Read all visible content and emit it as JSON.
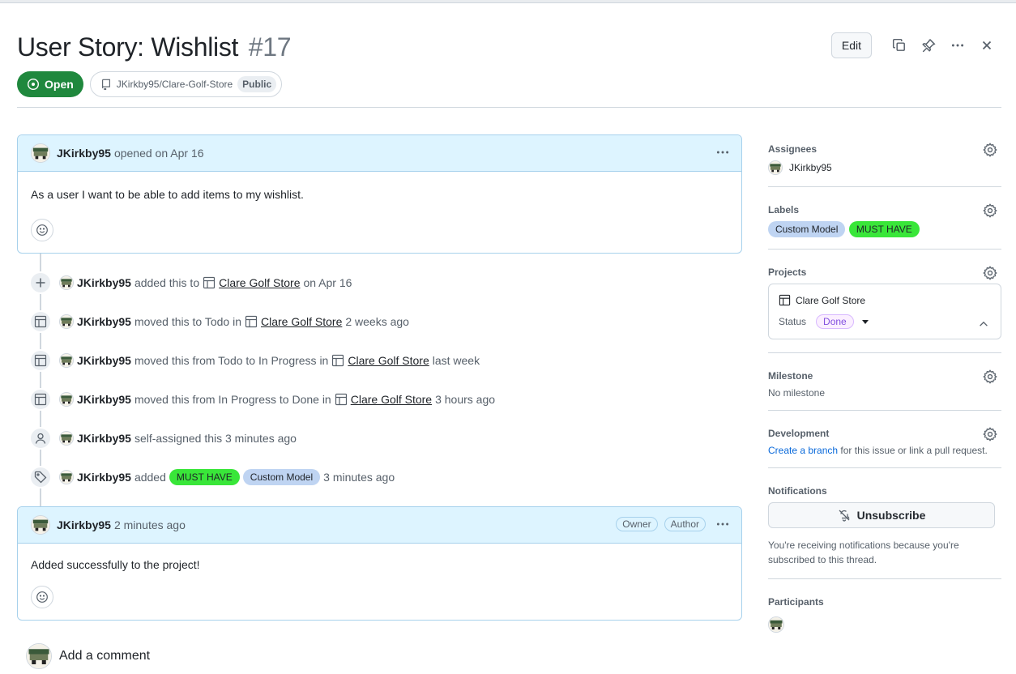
{
  "issue": {
    "title": "User Story: Wishlist",
    "number": "#17",
    "state": "Open",
    "repo": "JKirkby95/Clare-Golf-Store",
    "visibility": "Public",
    "edit_label": "Edit"
  },
  "opening_comment": {
    "author": "JKirkby95",
    "meta": "opened on Apr 16",
    "body": "As a user I want to be able to add items to my wishlist."
  },
  "timeline": [
    {
      "icon": "plus-icon",
      "who": "JKirkby95",
      "pre": "added this to",
      "project": "Clare Golf Store",
      "post": "on Apr 16"
    },
    {
      "icon": "table-icon",
      "who": "JKirkby95",
      "pre": "moved this to Todo in",
      "project": "Clare Golf Store",
      "post": "2 weeks ago"
    },
    {
      "icon": "table-icon",
      "who": "JKirkby95",
      "pre": "moved this from Todo to In Progress in",
      "project": "Clare Golf Store",
      "post": "last week"
    },
    {
      "icon": "table-icon",
      "who": "JKirkby95",
      "pre": "moved this from In Progress to Done in",
      "project": "Clare Golf Store",
      "post": "3 hours ago"
    },
    {
      "icon": "person-icon",
      "who": "JKirkby95",
      "pre": "self-assigned this 3 minutes ago"
    },
    {
      "icon": "tag-icon",
      "who": "JKirkby95",
      "pre": "added",
      "labels": [
        "MUST HAVE",
        "Custom Model"
      ],
      "post": "3 minutes ago"
    }
  ],
  "second_comment": {
    "author": "JKirkby95",
    "meta": "2 minutes ago",
    "badge_owner": "Owner",
    "badge_author": "Author",
    "body": "Added successfully to the project!"
  },
  "add_comment_label": "Add a comment",
  "sidebar": {
    "assignees": {
      "title": "Assignees",
      "user": "JKirkby95"
    },
    "labels": {
      "title": "Labels",
      "items": [
        "Custom Model",
        "MUST HAVE"
      ]
    },
    "projects": {
      "title": "Projects",
      "project": "Clare Golf Store",
      "status_label": "Status",
      "status_value": "Done"
    },
    "milestone": {
      "title": "Milestone",
      "value": "No milestone"
    },
    "development": {
      "title": "Development",
      "link": "Create a branch",
      "rest": "for this issue or link a pull request."
    },
    "notifications": {
      "title": "Notifications",
      "button": "Unsubscribe",
      "note": "You're receiving notifications because you're subscribed to this thread."
    },
    "participants": {
      "title": "Participants"
    }
  },
  "colors": {
    "open": "#1f883d",
    "must_have": "#39e639",
    "custom_model": "#bfd4f2",
    "comment_header": "#ddf4ff"
  }
}
